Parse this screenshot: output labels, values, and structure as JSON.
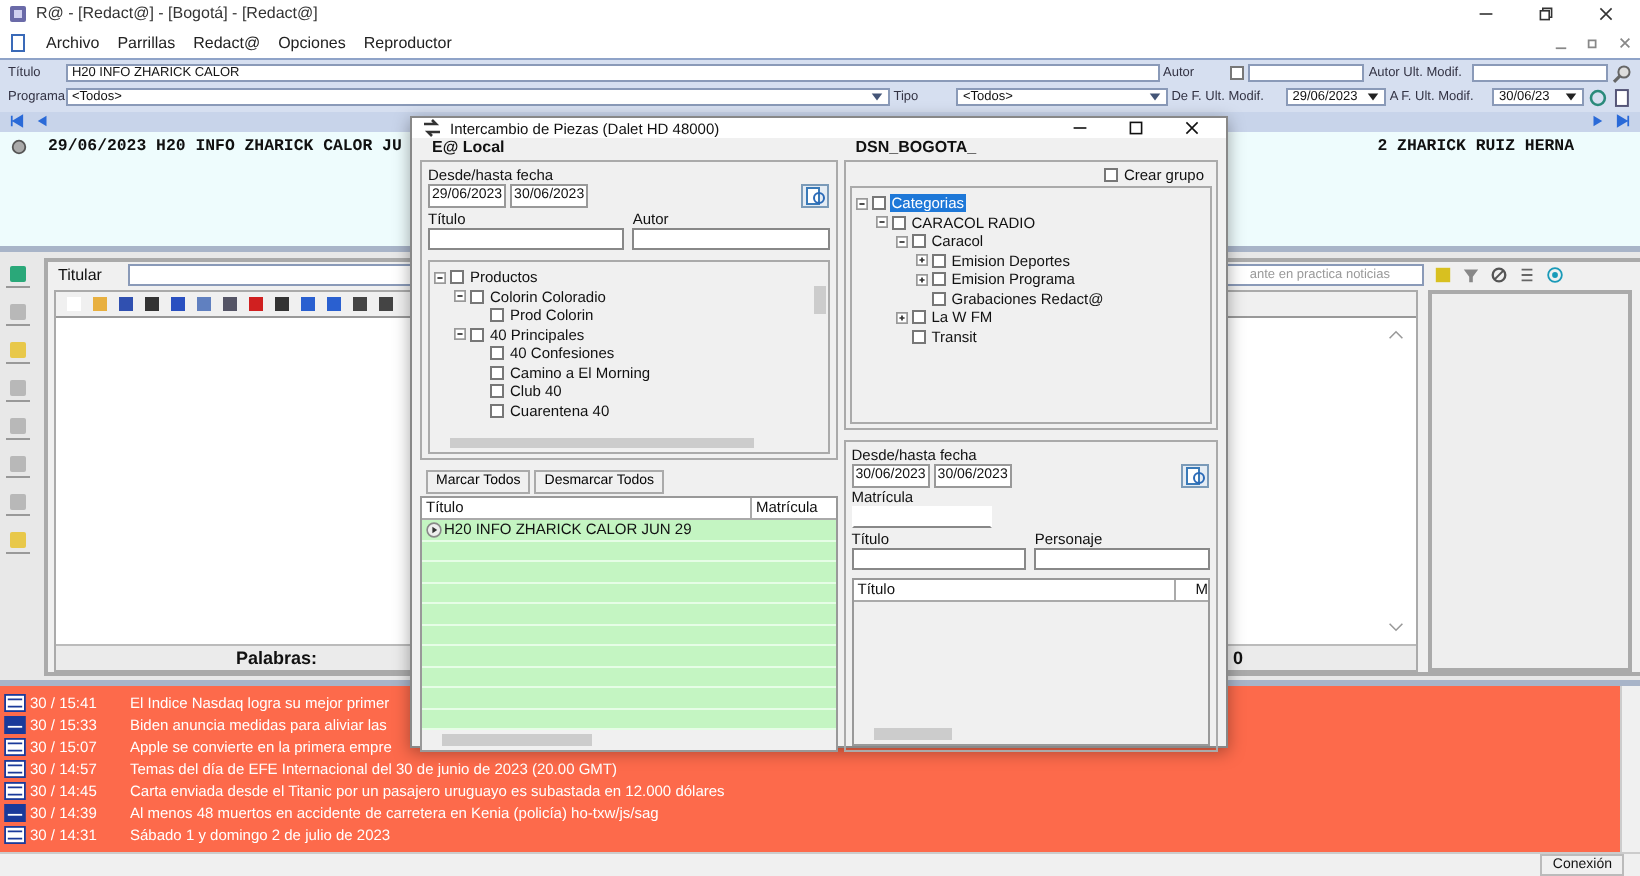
{
  "window": {
    "title": "R@ - [Redact@] - [Bogotá] - [Redact@]"
  },
  "menu": [
    "Archivo",
    "Parrillas",
    "Redact@",
    "Opciones",
    "Reproductor"
  ],
  "filters": {
    "titulo_label": "Título",
    "titulo_value": "H20 INFO ZHARICK CALOR",
    "autor_label": "Autor",
    "autor_checked": false,
    "autor_ult_label": "Autor Ult. Modif.",
    "programa_label": "Programa",
    "programa_value": "<Todos>",
    "tipo_label": "Tipo",
    "tipo_value": "<Todos>",
    "desde_label": "De F. Ult. Modif.",
    "desde_value": "29/06/2023",
    "hasta_label": "A F. Ult. Modif.",
    "hasta_value": "30/06/23"
  },
  "result_row": {
    "left": "29/06/2023 H20 INFO ZHARICK CALOR JU",
    "right": "2  ZHARICK RUIZ HERNA"
  },
  "editor": {
    "titular_label": "Titular",
    "titular_placeholder": "ante en practica noticias",
    "words_label": "Palabras:",
    "words_count": "0"
  },
  "news": [
    {
      "kind": "efe",
      "time": "30 / 15:41",
      "text": "El Indice Nasdaq logra su mejor primer"
    },
    {
      "kind": "afp",
      "time": "30 / 15:33",
      "text": "Biden anuncia medidas para aliviar las"
    },
    {
      "kind": "efe",
      "time": "30 / 15:07",
      "text": "Apple se convierte en la primera empre"
    },
    {
      "kind": "efe",
      "time": "30 / 14:57",
      "text": "Temas del día de EFE Internacional del 30 de junio de 2023 (20.00 GMT)"
    },
    {
      "kind": "efe",
      "time": "30 / 14:45",
      "text": "Carta enviada desde el Titanic por un pasajero uruguayo es subastada en 12.000 dólares"
    },
    {
      "kind": "afp",
      "time": "30 / 14:39",
      "text": "Al menos 48 muertos en accidente de carretera en Kenia (policía) ho-txw/js/sag"
    },
    {
      "kind": "efe",
      "time": "30 / 14:31",
      "text": "Sábado 1 y domingo 2 de julio de 2023"
    }
  ],
  "status_bar": {
    "connection": "Conexión"
  },
  "dialog": {
    "title": "Intercambio de Piezas (Dalet HD 48000)",
    "local": {
      "heading": "E@ Local",
      "date_label": "Desde/hasta fecha",
      "date_from": "29/06/2023",
      "date_to": "30/06/2023",
      "title_label": "Título",
      "author_label": "Autor",
      "tree": [
        {
          "label": "Productos",
          "checked": false,
          "selected": false,
          "expanded": true,
          "children": [
            {
              "label": "Colorin Coloradio",
              "checked": false,
              "selected": false,
              "expanded": true,
              "children": [
                {
                  "label": "Prod Colorin",
                  "checked": false,
                  "selected": false
                }
              ]
            },
            {
              "label": "40 Principales",
              "checked": false,
              "selected": false,
              "expanded": true,
              "children": [
                {
                  "label": "40 Confesiones",
                  "checked": false,
                  "selected": false
                },
                {
                  "label": "Camino a El Morning",
                  "checked": false,
                  "selected": false
                },
                {
                  "label": "Club 40",
                  "checked": false,
                  "selected": false
                },
                {
                  "label": "Cuarentena 40",
                  "checked": false,
                  "selected": false
                }
              ]
            }
          ]
        }
      ],
      "buttons": [
        "Marcar Todos",
        "Desmarcar Todos"
      ],
      "columns": [
        "Título",
        "Matrícula"
      ],
      "rows": [
        {
          "title": "H20 INFO ZHARICK CALOR JUN 29"
        }
      ]
    },
    "remote": {
      "heading": "DSN_BOGOTA_",
      "group": {
        "label": "Crear grupo",
        "checked": false
      },
      "tree": [
        {
          "label": "Categorias",
          "checked": false,
          "selected": true,
          "expanded": true,
          "children": [
            {
              "label": "CARACOL RADIO",
              "checked": false,
              "selected": false,
              "expanded": true,
              "children": [
                {
                  "label": "Caracol",
                  "checked": false,
                  "selected": false,
                  "expanded": true,
                  "children": [
                    {
                      "label": "Emision Deportes",
                      "checked": false,
                      "selected": false,
                      "expanded": false
                    },
                    {
                      "label": "Emision Programa",
                      "checked": false,
                      "selected": false,
                      "expanded": false
                    },
                    {
                      "label": "Grabaciones Redact@",
                      "checked": false,
                      "selected": false
                    }
                  ]
                },
                {
                  "label": "La W FM",
                  "checked": false,
                  "selected": false,
                  "expanded": false
                },
                {
                  "label": "Transit",
                  "checked": false,
                  "selected": false
                }
              ]
            }
          ]
        }
      ],
      "date_label": "Desde/hasta fecha",
      "date_from": "30/06/2023",
      "date_to": "30/06/2023",
      "matricula_label": "Matrícula",
      "title_label": "Título",
      "personaje_label": "Personaje",
      "columns": [
        "Título",
        "M"
      ]
    }
  }
}
